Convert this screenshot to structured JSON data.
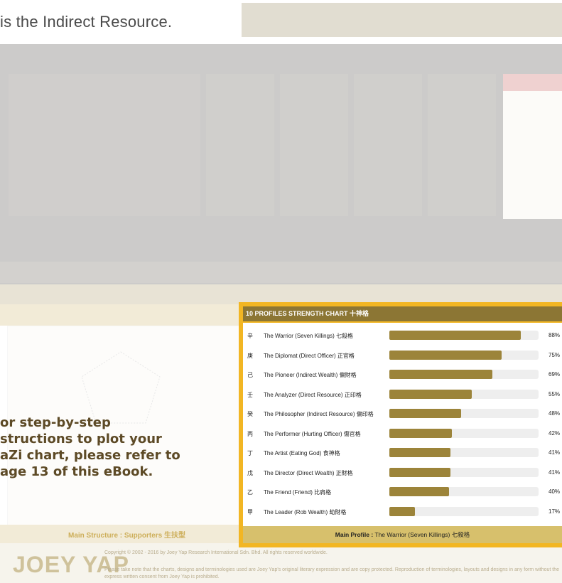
{
  "intro": "is the Indirect Resource.",
  "note": "or step-by-step\nstructions to plot your\naZi chart, please refer to\nage 13 of this eBook.",
  "background": {
    "main_structure": "Main Structure : Supporters 生扶型",
    "copyright": "Copyright © 2002 - 2016 by Joey Yap Research International Sdn. Bhd. All rights reserved worldwide.",
    "disclaimer": "Please take note that the charts, designs and terminologies used are Joey Yap's original literary expression and are copy protected. Reproduction of terminologies, layouts and designs in any form without the express written consent from Joey Yap is prohibited.",
    "brand": "JOEY YAP"
  },
  "chart_data": {
    "type": "bar",
    "title": "10 PROFILES STRENGTH CHART 十神格",
    "categories": [
      "The Warrior (Seven Killings) 七殺格",
      "The Diplomat (Direct Officer) 正官格",
      "The Pioneer (Indirect Wealth) 偏財格",
      "The Analyzer (Direct Resource) 正印格",
      "The Philosopher (Indirect Resource) 偏印格",
      "The Performer (Hurting Officer) 傷官格",
      "The Artist (Eating God) 食神格",
      "The Director (Direct Wealth) 正財格",
      "The Friend (Friend) 比肩格",
      "The Leader (Rob Wealth) 劫財格"
    ],
    "stems": [
      "辛",
      "庚",
      "己",
      "壬",
      "癸",
      "丙",
      "丁",
      "戊",
      "乙",
      "甲"
    ],
    "values": [
      88,
      75,
      69,
      55,
      48,
      42,
      41,
      41,
      40,
      17
    ],
    "labels": [
      "88%",
      "75%",
      "69%",
      "55%",
      "48%",
      "42%",
      "41%",
      "41%",
      "40%",
      "17%"
    ],
    "xlim": [
      0,
      100
    ],
    "bar_color": "#9c843a"
  },
  "footer": {
    "label": "Main Profile :",
    "value": "The Warrior (Seven Killings) 七殺格"
  },
  "colors": {
    "accent": "#f2b623",
    "header": "#8c7634",
    "footer": "#d7c06c"
  }
}
